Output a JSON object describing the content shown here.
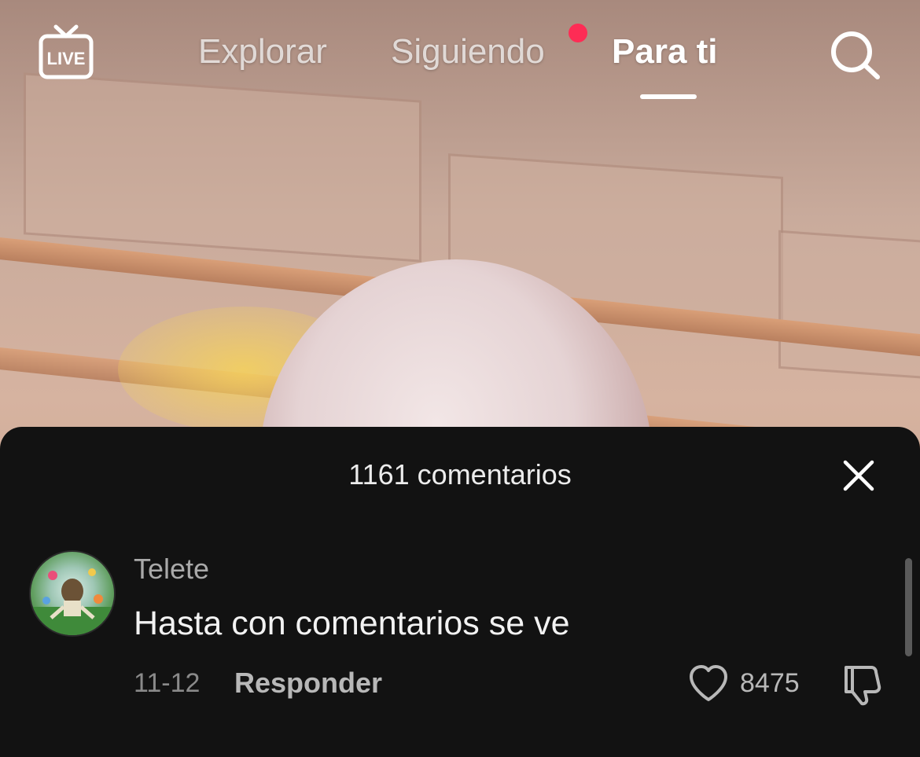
{
  "topbar": {
    "live_icon": "live-tv-icon",
    "tabs": [
      {
        "label": "Explorar"
      },
      {
        "label": "Siguiendo",
        "has_notification_dot": true
      },
      {
        "label": "Para ti",
        "active": true
      }
    ],
    "search_icon": "search-icon",
    "accent_color": "#fe2c55"
  },
  "comments_sheet": {
    "title": "1161 comentarios",
    "close_icon": "close-icon",
    "comments": [
      {
        "username": "Telete",
        "text": "Hasta con comentarios se ve",
        "date": "11-12",
        "reply_label": "Responder",
        "likes": "8475",
        "like_icon": "heart-icon",
        "dislike_icon": "thumbs-down-icon"
      }
    ]
  }
}
